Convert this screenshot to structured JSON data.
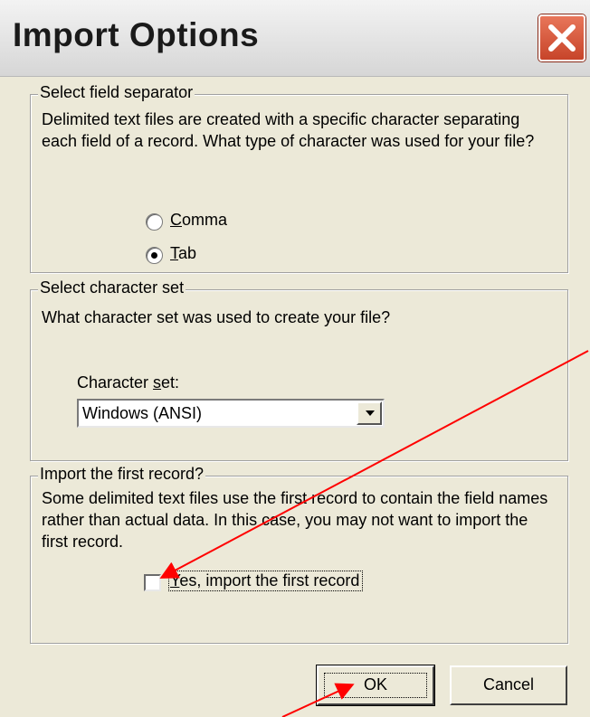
{
  "dialog": {
    "title": "Import Options",
    "close_icon": "close-x-icon"
  },
  "separator_group": {
    "legend": "Select field separator",
    "description": "Delimited text files are created with a specific character separating each field of a record.  What type of character was used for your file?",
    "options": [
      {
        "label_key": "C",
        "label_rest": "omma",
        "selected": false
      },
      {
        "label_key": "T",
        "label_rest": "ab",
        "selected": true
      }
    ]
  },
  "charset_group": {
    "legend": "Select character set",
    "question": "What character set was used to create your file?",
    "label_pre": "Character ",
    "label_key": "s",
    "label_post": "et:",
    "selected_value": "Windows (ANSI)"
  },
  "first_record_group": {
    "legend": "Import the first record?",
    "description": "Some delimited text files use the first record to contain the field names rather than actual data.  In this case, you may not want to import the first record.",
    "checkbox_key": "Y",
    "checkbox_rest": "es, import the first record",
    "checked": false
  },
  "buttons": {
    "ok": "OK",
    "cancel": "Cancel"
  },
  "annotation_color": "#ff0000"
}
